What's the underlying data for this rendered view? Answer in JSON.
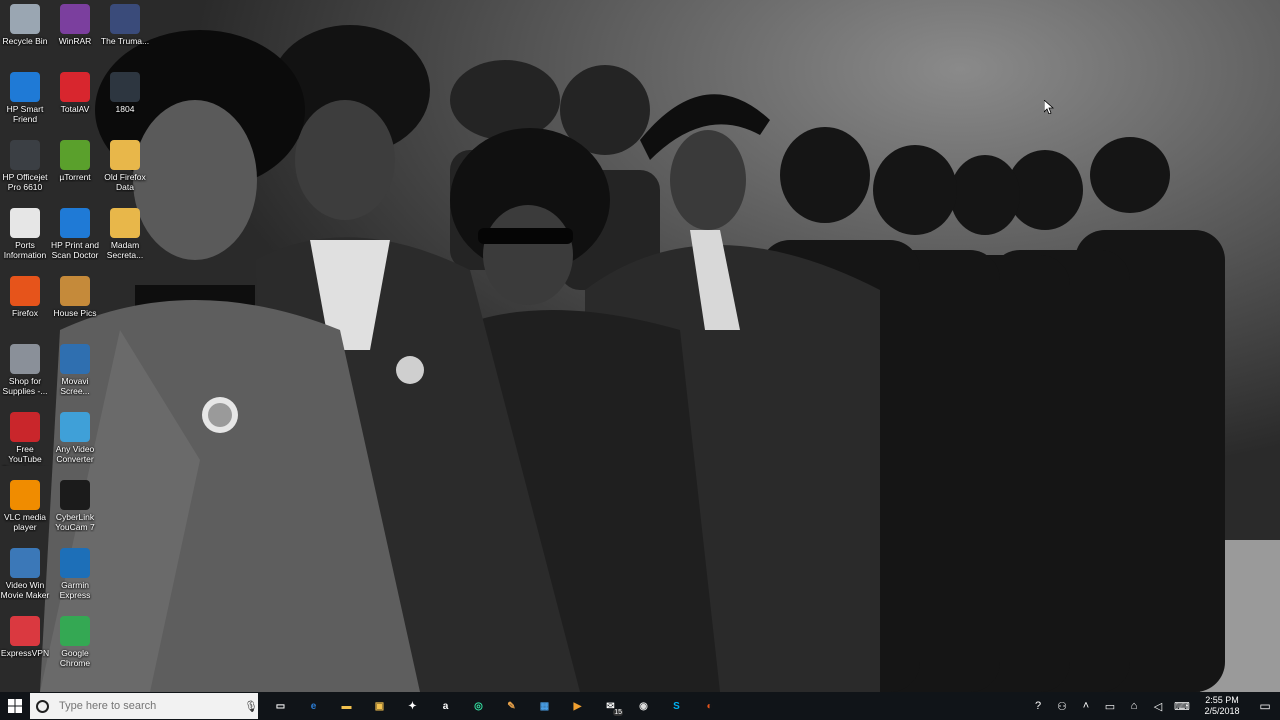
{
  "desktop_icons": [
    {
      "label": "Recycle Bin",
      "icon": "recycle-bin-icon",
      "color": "#9aa6b2"
    },
    {
      "label": "WinRAR",
      "icon": "winrar-icon",
      "color": "#7b3f9e"
    },
    {
      "label": "The Truma...",
      "icon": "video-file-icon",
      "color": "#3a4b7a"
    },
    {
      "label": "HP Smart\nFriend",
      "icon": "hp-smart-friend-icon",
      "color": "#1f7ad6"
    },
    {
      "label": "TotalAV",
      "icon": "totalav-shield-icon",
      "color": "#d8262e"
    },
    {
      "label": "1804",
      "icon": "image-file-icon",
      "color": "#2d3640"
    },
    {
      "label": "HP Officejet\nPro 6610",
      "icon": "printer-icon",
      "color": "#3b3f44"
    },
    {
      "label": "µTorrent",
      "icon": "utorrent-icon",
      "color": "#5aa02c"
    },
    {
      "label": "Old Firefox\nData",
      "icon": "folder-icon",
      "color": "#e8b74a"
    },
    {
      "label": "Ports\nInformation",
      "icon": "text-document-icon",
      "color": "#e6e6e6"
    },
    {
      "label": "HP Print and\nScan Doctor",
      "icon": "hp-print-scan-doctor-icon",
      "color": "#1f7ad6"
    },
    {
      "label": "Madam\nSecreta...",
      "icon": "folder-icon",
      "color": "#e8b74a"
    },
    {
      "label": "Firefox",
      "icon": "firefox-icon",
      "color": "#e6541b"
    },
    {
      "label": "House Pics",
      "icon": "folder-icon",
      "color": "#c58a3a"
    },
    {
      "label": "Shop for\nSupplies -...",
      "icon": "printer-supplies-icon",
      "color": "#8a9099"
    },
    {
      "label": "Movavi\nScree...",
      "icon": "movavi-icon",
      "color": "#2f6fb0"
    },
    {
      "label": "Free YouTube\nDownloader",
      "icon": "youtube-downloader-icon",
      "color": "#c9262b"
    },
    {
      "label": "Any Video\nConverter",
      "icon": "any-video-converter-icon",
      "color": "#3fa0d8"
    },
    {
      "label": "VLC media\nplayer",
      "icon": "vlc-icon",
      "color": "#f08c00"
    },
    {
      "label": "CyberLink\nYouCam 7",
      "icon": "cyberlink-youcam-icon",
      "color": "#1b1b1b"
    },
    {
      "label": "Video Win\nMovie Maker",
      "icon": "movie-maker-icon",
      "color": "#3b78b8"
    },
    {
      "label": "Garmin\nExpress",
      "icon": "garmin-express-icon",
      "color": "#1d6fb8"
    },
    {
      "label": "ExpressVPN",
      "icon": "expressvpn-icon",
      "color": "#da3940"
    },
    {
      "label": "Google\nChrome",
      "icon": "chrome-icon",
      "color": "#34a853"
    }
  ],
  "taskbar": {
    "search_placeholder": "Type here to search",
    "pinned": [
      {
        "name": "task-view-icon",
        "glyph": "▭",
        "color": "#ffffff"
      },
      {
        "name": "edge-icon",
        "glyph": "e",
        "color": "#2b7cd3"
      },
      {
        "name": "file-explorer-icon",
        "glyph": "▬",
        "color": "#f2c14e"
      },
      {
        "name": "store-icon",
        "glyph": "▣",
        "color": "#f2c14e"
      },
      {
        "name": "dropbox-icon",
        "glyph": "✦",
        "color": "#ffffff"
      },
      {
        "name": "amazon-icon",
        "glyph": "a",
        "color": "#ffffff"
      },
      {
        "name": "tripadvisor-icon",
        "glyph": "◎",
        "color": "#34e0a1"
      },
      {
        "name": "paint-icon",
        "glyph": "✎",
        "color": "#e8a24a"
      },
      {
        "name": "photos-icon",
        "glyph": "▦",
        "color": "#4aa0e8"
      },
      {
        "name": "media-player-icon",
        "glyph": "▶",
        "color": "#f0a030"
      },
      {
        "name": "mail-icon",
        "glyph": "✉",
        "color": "#ffffff"
      },
      {
        "name": "camera-app-icon",
        "glyph": "◉",
        "color": "#dddddd"
      },
      {
        "name": "skype-icon",
        "glyph": "S",
        "color": "#00aff0"
      },
      {
        "name": "firefox-taskbar-icon",
        "glyph": "◐",
        "color": "#e6541b"
      }
    ],
    "mail_badge": "15",
    "tray": [
      {
        "name": "help-tray-icon",
        "glyph": "?"
      },
      {
        "name": "people-tray-icon",
        "glyph": "⚇"
      },
      {
        "name": "chevron-up-icon",
        "glyph": "˄"
      },
      {
        "name": "battery-icon",
        "glyph": "▭"
      },
      {
        "name": "network-icon",
        "glyph": "⌂"
      },
      {
        "name": "volume-icon",
        "glyph": "◁"
      },
      {
        "name": "keyboard-icon",
        "glyph": "⌨"
      }
    ],
    "time": "2:55 PM",
    "date": "2/5/2018"
  }
}
